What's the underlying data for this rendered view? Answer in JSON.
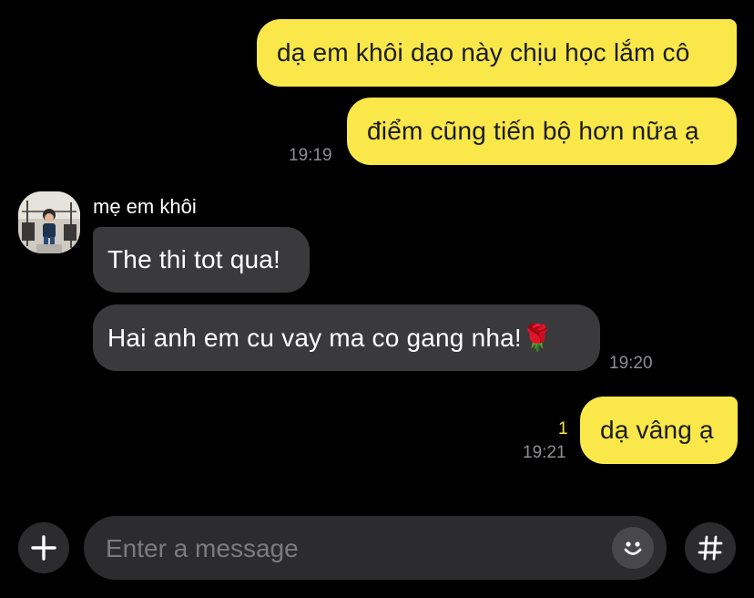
{
  "conversation": {
    "messages": [
      {
        "direction": "out",
        "text": "dạ em khôi dạo này chịu học lắm cô"
      },
      {
        "direction": "out",
        "text": "điểm cũng tiến bộ hơn nữa ạ",
        "time": "19:19"
      },
      {
        "direction": "in",
        "sender": "mẹ em khôi",
        "text": "The thi tot qua!"
      },
      {
        "direction": "in",
        "text": "Hai anh em cu vay ma co gang nha!🌹",
        "time": "19:20"
      },
      {
        "direction": "out",
        "text": "dạ vâng ạ",
        "time": "19:21",
        "unread_count": "1"
      }
    ]
  },
  "composer": {
    "placeholder": "Enter a message",
    "value": "",
    "add_icon": "plus-icon",
    "emoji_icon": "smiley-icon",
    "hashtag_icon": "hashtag-icon"
  },
  "colors": {
    "outgoing_bubble": "#fae84a",
    "incoming_bubble": "#3a3a3c",
    "background": "#000000",
    "timestamp": "#8e8e93"
  }
}
